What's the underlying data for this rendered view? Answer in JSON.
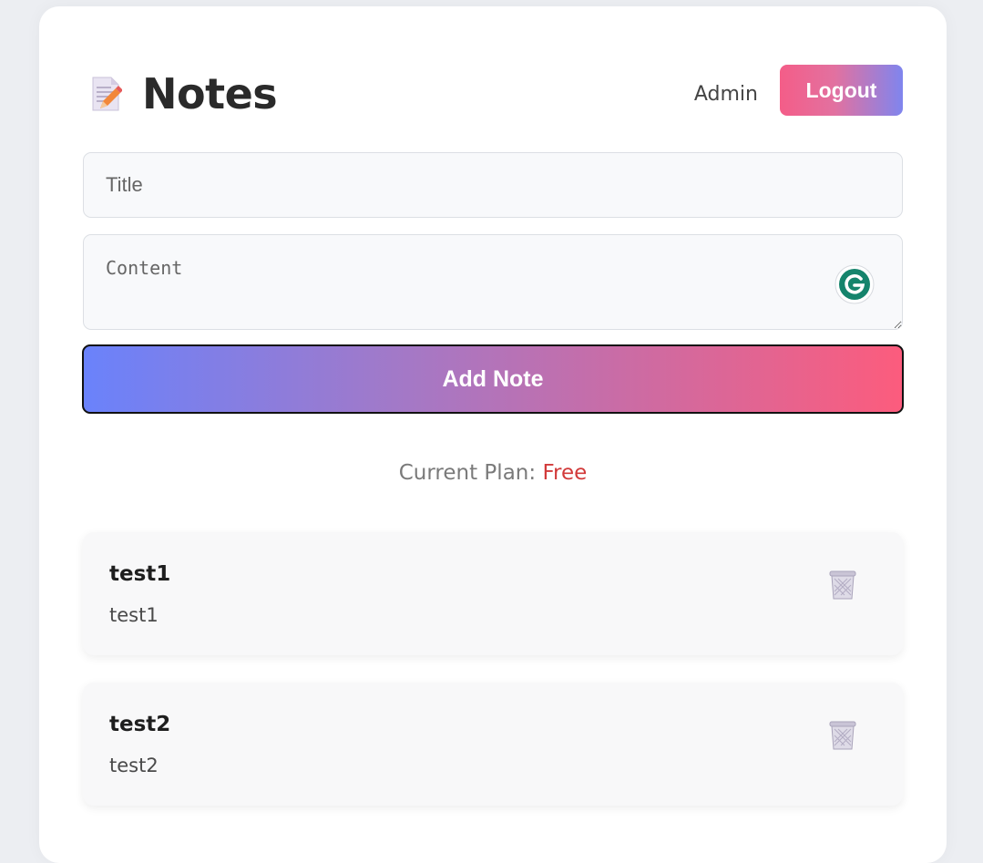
{
  "header": {
    "title": "Notes",
    "icon": "memo-icon",
    "user_name": "Admin",
    "logout_label": "Logout"
  },
  "form": {
    "title_placeholder": "Title",
    "title_value": "",
    "content_placeholder": "Content",
    "content_value": "",
    "submit_label": "Add Note"
  },
  "plan": {
    "label": "Current Plan:",
    "value": "Free"
  },
  "notes": [
    {
      "title": "test1",
      "content": "test1"
    },
    {
      "title": "test2",
      "content": "test2"
    }
  ],
  "colors": {
    "gradient_blue": "#6a82fb",
    "gradient_pink": "#fc5c7d",
    "plan_value": "#d23a3a",
    "grammarly": "#15846c"
  }
}
